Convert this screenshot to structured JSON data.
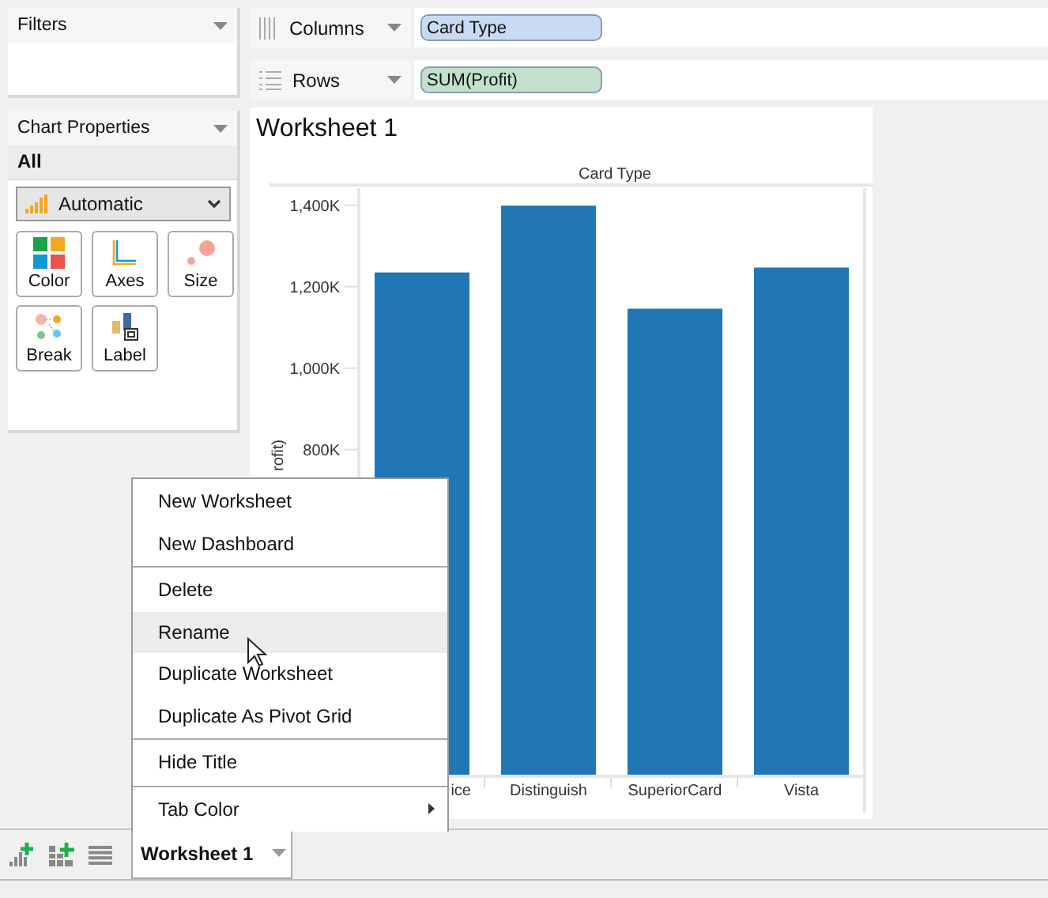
{
  "filters_panel": {
    "title": "Filters"
  },
  "chart_properties": {
    "title": "Chart Properties",
    "section": "All",
    "chart_type": "Automatic",
    "buttons": [
      {
        "label": "Color",
        "kind": "color"
      },
      {
        "label": "Axes",
        "kind": "axes"
      },
      {
        "label": "Size",
        "kind": "size"
      },
      {
        "label": "Break",
        "kind": "break"
      },
      {
        "label": "Label",
        "kind": "label"
      }
    ]
  },
  "shelves": [
    {
      "label": "Columns",
      "kind": "columns",
      "pill": "Card Type",
      "color": "#c9daf4"
    },
    {
      "label": "Rows",
      "kind": "rows",
      "pill": "SUM(Profit)",
      "color": "#c3e0cd"
    }
  ],
  "worksheet": {
    "title": "Worksheet 1",
    "chart_data": {
      "type": "bar",
      "title": "Card Type",
      "ylabel": "rofit)",
      "categories": [
        "ice",
        "Distinguish",
        "SuperiorCard",
        "Vista"
      ],
      "series": [
        {
          "color": "#2077b4",
          "values": [
            1233,
            1397,
            1144,
            1245
          ]
        }
      ],
      "ylim": [
        0,
        1440
      ],
      "yticks": [
        {
          "value": 800,
          "label": "800K"
        },
        {
          "value": 1000,
          "label": "1,000K"
        },
        {
          "value": 1200,
          "label": "1,200K"
        },
        {
          "value": 1400,
          "label": "1,400K"
        }
      ]
    }
  },
  "context_menu": {
    "groups": [
      [
        {
          "label": "New Worksheet",
          "selected": false
        },
        {
          "label": "New Dashboard",
          "selected": false
        }
      ],
      [
        {
          "label": "Delete",
          "selected": false
        },
        {
          "label": "Rename",
          "selected": true
        },
        {
          "label": "Duplicate Worksheet",
          "selected": false
        },
        {
          "label": "Duplicate As Pivot Grid",
          "selected": false
        }
      ],
      [
        {
          "label": "Hide Title",
          "selected": false
        }
      ],
      [
        {
          "label": "Tab Color",
          "selected": false,
          "submenu": true
        }
      ]
    ]
  },
  "sheet_tabs": [
    {
      "label": "Worksheet 1",
      "selected": true
    }
  ]
}
